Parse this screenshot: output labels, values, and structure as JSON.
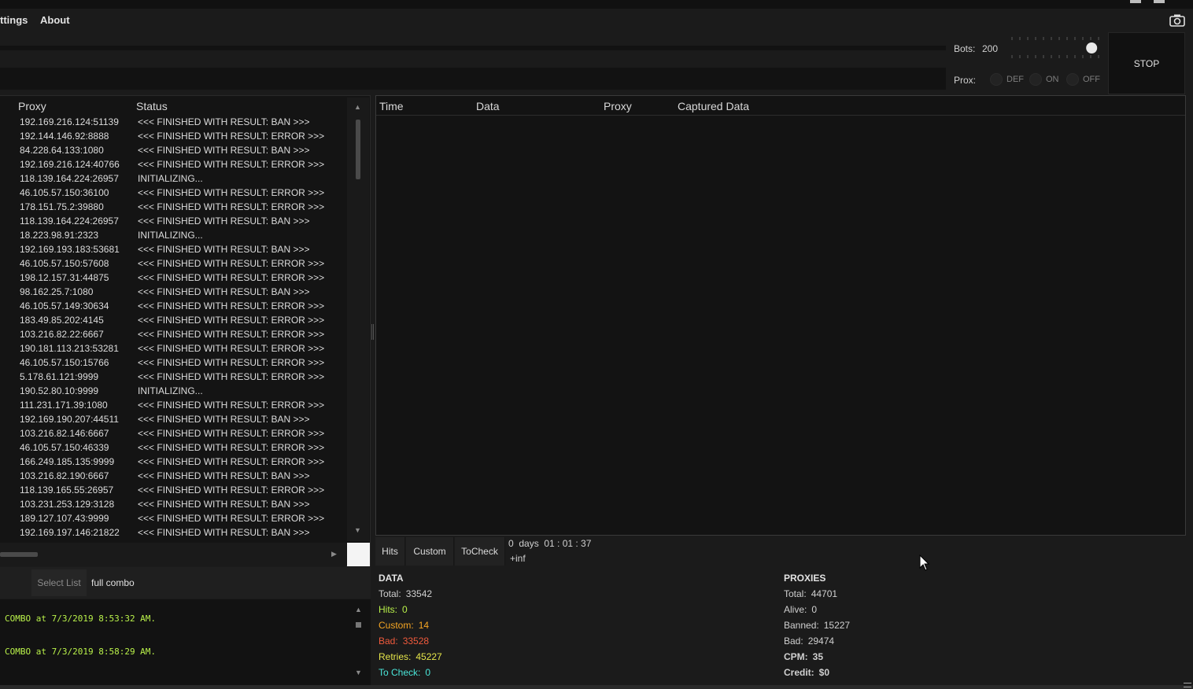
{
  "menu": {
    "settings": "ttings",
    "about": "About"
  },
  "controls": {
    "bots_label": "Bots:",
    "bots_value": "200",
    "prox_label": "Prox:",
    "prox_options": [
      "DEF",
      "ON",
      "OFF"
    ],
    "stop_label": "STOP",
    "bots_slider_fraction": 0.92
  },
  "proxy_grid": {
    "columns": [
      "Proxy",
      "Status"
    ],
    "rows": [
      [
        "192.169.216.124:51139",
        "<<< FINISHED WITH RESULT: BAN >>>"
      ],
      [
        "192.144.146.92:8888",
        "<<< FINISHED WITH RESULT: ERROR >>>"
      ],
      [
        "84.228.64.133:1080",
        "<<< FINISHED WITH RESULT: BAN >>>"
      ],
      [
        "192.169.216.124:40766",
        "<<< FINISHED WITH RESULT: ERROR >>>"
      ],
      [
        "118.139.164.224:26957",
        "INITIALIZING..."
      ],
      [
        "46.105.57.150:36100",
        "<<< FINISHED WITH RESULT: ERROR >>>"
      ],
      [
        "178.151.75.2:39880",
        "<<< FINISHED WITH RESULT: ERROR >>>"
      ],
      [
        "118.139.164.224:26957",
        "<<< FINISHED WITH RESULT: BAN >>>"
      ],
      [
        "18.223.98.91:2323",
        "INITIALIZING..."
      ],
      [
        "192.169.193.183:53681",
        "<<< FINISHED WITH RESULT: BAN >>>"
      ],
      [
        "46.105.57.150:57608",
        "<<< FINISHED WITH RESULT: ERROR >>>"
      ],
      [
        "198.12.157.31:44875",
        "<<< FINISHED WITH RESULT: ERROR >>>"
      ],
      [
        "98.162.25.7:1080",
        "<<< FINISHED WITH RESULT: BAN >>>"
      ],
      [
        "46.105.57.149:30634",
        "<<< FINISHED WITH RESULT: ERROR >>>"
      ],
      [
        "183.49.85.202:4145",
        "<<< FINISHED WITH RESULT: ERROR >>>"
      ],
      [
        "103.216.82.22:6667",
        "<<< FINISHED WITH RESULT: ERROR >>>"
      ],
      [
        "190.181.113.213:53281",
        "<<< FINISHED WITH RESULT: ERROR >>>"
      ],
      [
        "46.105.57.150:15766",
        "<<< FINISHED WITH RESULT: ERROR >>>"
      ],
      [
        "5.178.61.121:9999",
        "<<< FINISHED WITH RESULT: ERROR >>>"
      ],
      [
        "190.52.80.10:9999",
        "INITIALIZING..."
      ],
      [
        "111.231.171.39:1080",
        "<<< FINISHED WITH RESULT: ERROR >>>"
      ],
      [
        "192.169.190.207:44511",
        "<<< FINISHED WITH RESULT: BAN >>>"
      ],
      [
        "103.216.82.146:6667",
        "<<< FINISHED WITH RESULT: ERROR >>>"
      ],
      [
        "46.105.57.150:46339",
        "<<< FINISHED WITH RESULT: ERROR >>>"
      ],
      [
        "166.249.185.135:9999",
        "<<< FINISHED WITH RESULT: ERROR >>>"
      ],
      [
        "103.216.82.190:6667",
        "<<< FINISHED WITH RESULT: BAN >>>"
      ],
      [
        "118.139.165.55:26957",
        "<<< FINISHED WITH RESULT: ERROR >>>"
      ],
      [
        "103.231.253.129:3128",
        "<<< FINISHED WITH RESULT: BAN >>>"
      ],
      [
        "189.127.107.43:9999",
        "<<< FINISHED WITH RESULT: ERROR >>>"
      ],
      [
        "192.169.197.146:21822",
        "<<< FINISHED WITH RESULT: BAN >>>"
      ]
    ]
  },
  "results_grid": {
    "columns": [
      "Time",
      "Data",
      "Proxy",
      "Captured Data"
    ]
  },
  "tabs": [
    "Hits",
    "Custom",
    "ToCheck"
  ],
  "runtime": {
    "elapsed": "0  days  01 : 01 : 37",
    "eta": "+inf"
  },
  "select_list": {
    "button": "Select List",
    "name": "full combo"
  },
  "log": [
    "COMBO at 7/3/2019 8:53:32 AM.",
    "COMBO at 7/3/2019 8:58:29 AM."
  ],
  "data_stats": {
    "title": "DATA",
    "items": [
      {
        "label": "Total:",
        "value": "33542",
        "color": "#d0d0d0"
      },
      {
        "label": "Hits:",
        "value": "0",
        "color": "#b9f14a"
      },
      {
        "label": "Custom:",
        "value": "14",
        "color": "#f5a623"
      },
      {
        "label": "Bad:",
        "value": "33528",
        "color": "#f05a3c"
      },
      {
        "label": "Retries:",
        "value": "45227",
        "color": "#e6e64a"
      },
      {
        "label": "To Check:",
        "value": "0",
        "color": "#4ae6d9"
      }
    ]
  },
  "proxy_stats": {
    "title": "PROXIES",
    "items": [
      {
        "label": "Total:",
        "value": "44701",
        "bold": false
      },
      {
        "label": "Alive:",
        "value": "0",
        "bold": false
      },
      {
        "label": "Banned:",
        "value": "15227",
        "bold": false
      },
      {
        "label": "Bad:",
        "value": "29474",
        "bold": false
      },
      {
        "label": "CPM:",
        "value": "35",
        "bold": true
      },
      {
        "label": "Credit:",
        "value": "$0",
        "bold": true
      }
    ]
  }
}
